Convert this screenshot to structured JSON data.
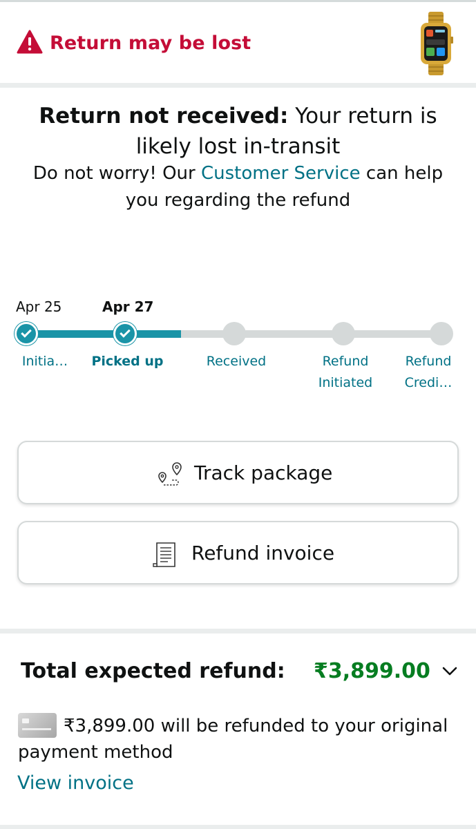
{
  "alert": {
    "title": "Return may be lost",
    "icon": "warning-triangle-icon",
    "color": "#c40d37"
  },
  "product": {
    "image": "gold-smartwatch-thumbnail"
  },
  "message": {
    "title_bold": "Return not received:",
    "title_rest": " Your return is likely lost in-transit",
    "sub_before": "Do not worry! Our ",
    "sub_link": "Customer Service",
    "sub_after": " can help you regarding the refund"
  },
  "tracker": {
    "accent": "#1a94a7",
    "dates": [
      "Apr 25",
      "Apr 27"
    ],
    "steps": [
      {
        "label": "Initia…",
        "status": "done"
      },
      {
        "label": "Picked up",
        "status": "done"
      },
      {
        "label": "Received",
        "status": "pending"
      },
      {
        "label": "Refund Initiated",
        "status": "pending"
      },
      {
        "label": "Refund Credi…",
        "status": "pending"
      }
    ]
  },
  "actions": {
    "track_label": "Track package",
    "invoice_label": "Refund invoice"
  },
  "refund": {
    "title": "Total expected refund:",
    "amount": "₹3,899.00",
    "amount_color": "#067d21",
    "description": "₹3,899.00 will be refunded to your original payment method",
    "view_invoice": "View invoice"
  }
}
